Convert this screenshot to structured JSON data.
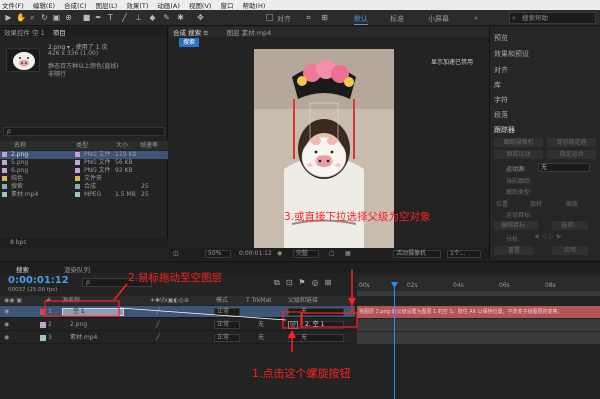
{
  "menu": [
    "文件(F)",
    "编辑(E)",
    "合成(C)",
    "图层(L)",
    "效果(T)",
    "动画(A)",
    "视图(V)",
    "窗口",
    "帮助(H)"
  ],
  "toolbar": {
    "align_label": "对齐",
    "workspaces": [
      "默认",
      "标准",
      "小屏幕"
    ],
    "workspace_more": "»",
    "search_placeholder": "搜索帮助"
  },
  "project": {
    "tabs": [
      "效果控件 空 1",
      "项目"
    ],
    "item_name": "2.png ▾ , 使用了 1 次",
    "item_dims": "426 x 336 (1.00)",
    "item_note1": "静态百万种以上颜色(直线)",
    "item_note2": "非隔行",
    "search_label": "ρ",
    "columns": [
      "名称",
      "类型",
      "大小",
      "帧速率"
    ],
    "rows": [
      {
        "name": "2.png",
        "type": "PNG 文件",
        "size": "119 KB",
        "fps": ""
      },
      {
        "name": "5.png",
        "type": "PNG 文件",
        "size": "56 KB",
        "fps": ""
      },
      {
        "name": "6.png",
        "type": "PNG 文件",
        "size": "92 KB",
        "fps": ""
      },
      {
        "name": "纯色",
        "type": "文件夹",
        "size": "",
        "fps": ""
      },
      {
        "name": "搜索",
        "type": "合成",
        "size": "",
        "fps": "25"
      },
      {
        "name": "素材.mp4",
        "type": "MPEG",
        "size": "1.5 MB",
        "fps": "25"
      }
    ],
    "footer": "8 bpc"
  },
  "viewer": {
    "tabs": [
      "合成 搜索 ≡",
      "图层 素材.mp4"
    ],
    "comp_tab": "搜索",
    "gpu_note": "显示加速已禁用",
    "zoom": "50%",
    "timecode": "0:00:01:12",
    "quality": "完整",
    "camera": "活动摄像机",
    "views": "1个..."
  },
  "right_panel": {
    "items": [
      "预览",
      "效果和预设",
      "对齐",
      "库",
      "字符",
      "段落",
      "跟踪器"
    ],
    "tracker_buttons": [
      "跟踪摄像机",
      "变形稳定器",
      "跟踪运动",
      "稳定运动"
    ],
    "motion_source_label": "运动源:",
    "motion_source_value": "无",
    "current_track_label": "当前跟踪:",
    "track_type_label": "跟踪类型:",
    "checkboxes": [
      "位置",
      "旋转",
      "缩放"
    ],
    "motion_target_label": "运动目标:",
    "edit_target": "编辑目标...",
    "options": "选项...",
    "analyze_label": "分析:",
    "reset": "重置",
    "apply": "应用"
  },
  "timeline": {
    "tabs": [
      "搜索",
      "渲染队列"
    ],
    "timecode": "0:00:01:12",
    "fps_note": "00037 (25.00 fps)",
    "search_placeholder": "ρ",
    "col_headers": [
      "#",
      "源名称",
      "模式",
      "T TrkMat",
      "父级和链接"
    ],
    "layers": [
      {
        "num": "1",
        "name": "空 1",
        "mode": "正常",
        "trkmat": "",
        "parent": "无"
      },
      {
        "num": "2",
        "name": "2.png",
        "mode": "正常",
        "trkmat": "无",
        "parent": "2. 空 1"
      },
      {
        "num": "3",
        "name": "素材.mp4",
        "mode": "正常",
        "trkmat": "无",
        "parent": "无"
      }
    ],
    "ruler": [
      "00s",
      "02s",
      "04s",
      "06s",
      "08s"
    ],
    "tooltip": "将图层 2.png 的父级设置为图层 1 的空 1。按住 Alt 以保持位置，不改变子级图层的变换。"
  },
  "annotations": {
    "a1": "1.点击这个螺旋按钮",
    "a2": "2.鼠标拖动至空图层",
    "a3": "3.或直接下拉选择父级为空对象"
  },
  "colors": {
    "annotation": "#ff2020",
    "selection": "#3d5677",
    "tooltip_bar": "#b25557",
    "playhead": "#2d8cf0"
  }
}
